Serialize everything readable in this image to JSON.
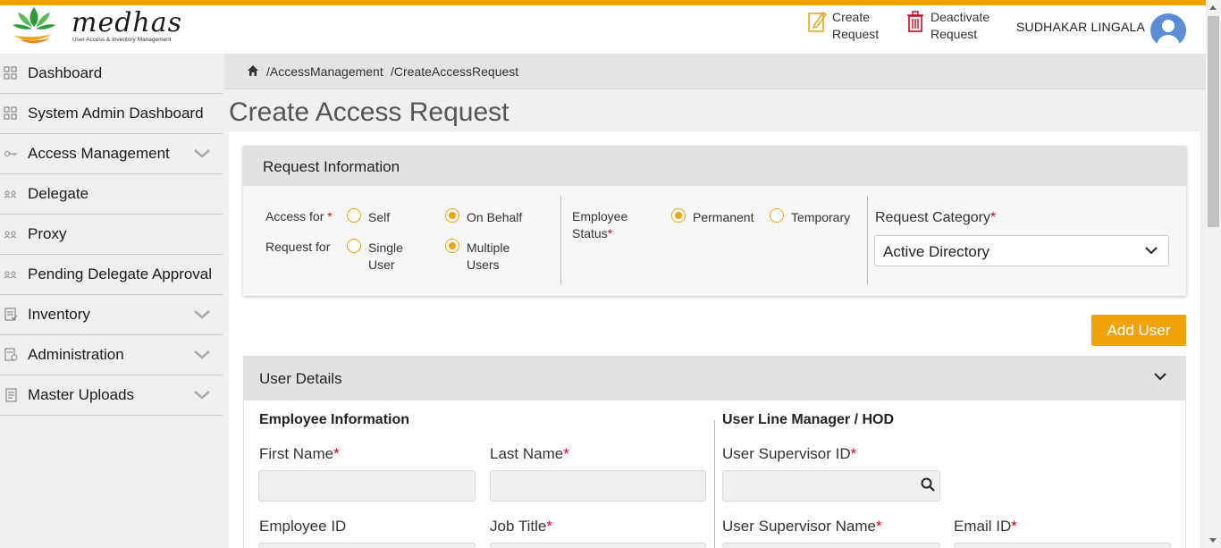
{
  "app": {
    "logo_text": "medhas",
    "logo_subtitle": "User Access & Inventory Management",
    "accent_color": "#f0a30a"
  },
  "header": {
    "create_request": [
      "Create",
      "Request"
    ],
    "deactivate_request": [
      "Deactivate",
      "Request"
    ],
    "username": "SUDHAKAR LINGALA"
  },
  "sidebar": {
    "items": [
      {
        "label": "Dashboard",
        "icon": "grid-icon"
      },
      {
        "label": "System Admin Dashboard",
        "icon": "grid-icon"
      },
      {
        "label": "Access Management",
        "icon": "key-icon",
        "expandable": true
      },
      {
        "label": "Delegate",
        "icon": "people-icon"
      },
      {
        "label": "Proxy",
        "icon": "people-icon"
      },
      {
        "label": "Pending Delegate Approval",
        "icon": "people-icon"
      },
      {
        "label": "Inventory",
        "icon": "checklist-icon",
        "expandable": true
      },
      {
        "label": "Administration",
        "icon": "admin-icon",
        "expandable": true
      },
      {
        "label": "Master Uploads",
        "icon": "document-icon",
        "expandable": true
      }
    ]
  },
  "breadcrumb": {
    "parts": [
      "/AccessManagement",
      "/CreateAccessRequest"
    ]
  },
  "page": {
    "title": "Create Access Request"
  },
  "request_info": {
    "title": "Request Information",
    "access_for_label": "Access for",
    "access_for_options": [
      "Self",
      "On Behalf"
    ],
    "access_for_selected": "On Behalf",
    "request_for_label": "Request for",
    "request_for_options": [
      [
        "Single",
        "User"
      ],
      [
        "Multiple",
        "Users"
      ]
    ],
    "request_for_selected": "Multiple Users",
    "employee_status_label": [
      "Employee",
      "Status"
    ],
    "employee_status_options": [
      "Permanent",
      "Temporary"
    ],
    "employee_status_selected": "Permanent",
    "request_category_label": "Request Category",
    "request_category_value": "Active Directory",
    "required_mark": "*"
  },
  "actions": {
    "add_user": "Add User"
  },
  "user_details": {
    "title": "User Details",
    "employee_section": "Employee Information",
    "manager_section": "User Line Manager / HOD",
    "fields": {
      "first_name": "First Name",
      "last_name": "Last Name",
      "employee_id": "Employee ID",
      "job_title": "Job Title",
      "supervisor_id": "User Supervisor ID",
      "supervisor_name": "User Supervisor Name",
      "email_id": "Email ID"
    },
    "values": {
      "first_name": "",
      "last_name": "",
      "supervisor_id": ""
    }
  }
}
